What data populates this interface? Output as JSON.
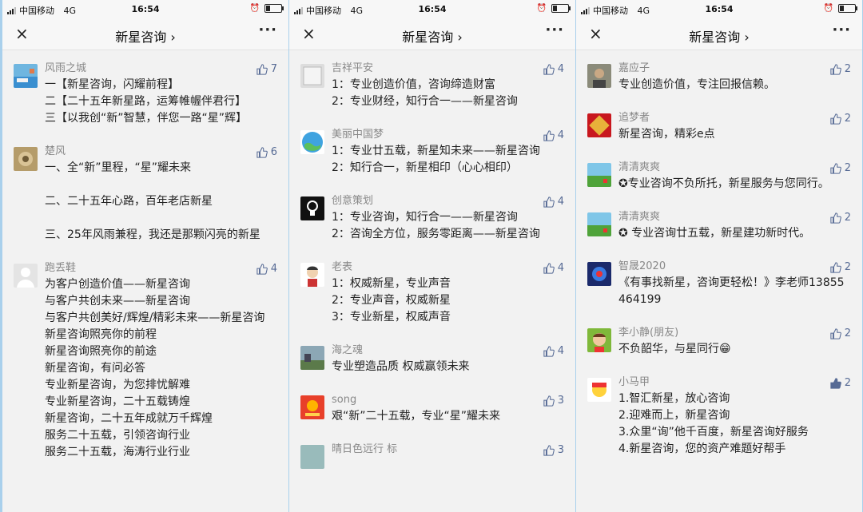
{
  "colors": {
    "accent": "#576b95",
    "background": "#f2f2f2",
    "border": "#a9d0ec"
  },
  "phones": [
    {
      "status": {
        "carrier": "中国移动",
        "network": "4G",
        "time": "16:54"
      },
      "nav": {
        "close_icon": "×",
        "title": "新星咨询 ›",
        "more_icon": "···"
      },
      "comments": [
        {
          "name": "风雨之城",
          "likes": "7",
          "text": "一【新星咨询，闪耀前程】\n二【二十五年新星路，运筹帷幄伴君行】\n三【以我创“新”智慧，伴您一路“星”辉】"
        },
        {
          "name": "楚风",
          "likes": "6",
          "text": "一、全“新”里程，“星”耀未来\n\n二、二十五年心路，百年老店新星\n\n三、25年风雨兼程，我还是那颗闪亮的新星"
        },
        {
          "name": "跑丢鞋",
          "likes": "4",
          "text": "为客户创造价值——新星咨询\n与客户共创未来——新星咨询\n与客户共创美好/辉煌/精彩未来——新星咨询\n新星咨询照亮你的前程\n新星咨询照亮你的前途\n新星咨询，有问必答\n专业新星咨询，为您排忧解难\n专业新星咨询，二十五载铸煌\n新星咨询，二十五年成就万千辉煌\n服务二十五载，引领咨询行业\n服务二十五载，海涛行业行业"
        }
      ]
    },
    {
      "status": {
        "carrier": "中国移动",
        "network": "4G",
        "time": "16:54"
      },
      "nav": {
        "close_icon": "×",
        "title": "新星咨询 ›",
        "more_icon": "···"
      },
      "comments": [
        {
          "name": "吉祥平安",
          "likes": "4",
          "text": "1：专业创造价值，咨询缔造财富\n2：专业财经，知行合一——新星咨询"
        },
        {
          "name": "美丽中国梦",
          "likes": "4",
          "text": "1：专业廿五载，新星知未来——新星咨询\n2：知行合一，新星相印（心心相印）"
        },
        {
          "name": "创意策划",
          "likes": "4",
          "text": "1：专业咨询，知行合一——新星咨询\n2：咨询全方位，服务零距离——新星咨询"
        },
        {
          "name": "老表",
          "likes": "4",
          "text": "1：权威新星，专业声音\n2：专业声音，权威新星\n3：专业新星，权威声音"
        },
        {
          "name": "海之魂",
          "likes": "4",
          "text": "专业塑造品质 权威赢领未来"
        },
        {
          "name": "song",
          "likes": "3",
          "text": "艰“新”二十五载，专业“星”耀未来"
        },
        {
          "name": "晴日色远行 标",
          "likes": "3",
          "text": ""
        }
      ]
    },
    {
      "status": {
        "carrier": "中国移动",
        "network": "4G",
        "time": "16:54"
      },
      "nav": {
        "close_icon": "×",
        "title": "新星咨询 ›",
        "more_icon": "···"
      },
      "comments": [
        {
          "name": "嘉应子",
          "likes": "2",
          "text": "专业创造价值，专注回报信赖。"
        },
        {
          "name": "追梦者",
          "likes": "2",
          "text": "新星咨询，精彩e点"
        },
        {
          "name": "清清爽爽",
          "likes": "2",
          "text": "✪专业咨询不负所托，新星服务与您同行。"
        },
        {
          "name": "清清爽爽",
          "likes": "2",
          "text": "✪ 专业咨询廿五载，新星建功新时代。"
        },
        {
          "name": "智晟2020",
          "likes": "2",
          "text": "《有事找新星，咨询更轻松！》李老师13855464199"
        },
        {
          "name": "李小静(朋友)",
          "likes": "2",
          "text": "不负韶华，与星同行😁"
        },
        {
          "name": "小马甲",
          "likes": "2",
          "text": "1.智汇新星，放心咨询\n2.迎难而上，新星咨询\n3.众里“询”他千百度，新星咨询好服务\n4.新星咨询，您的资产难题好帮手"
        }
      ]
    }
  ]
}
